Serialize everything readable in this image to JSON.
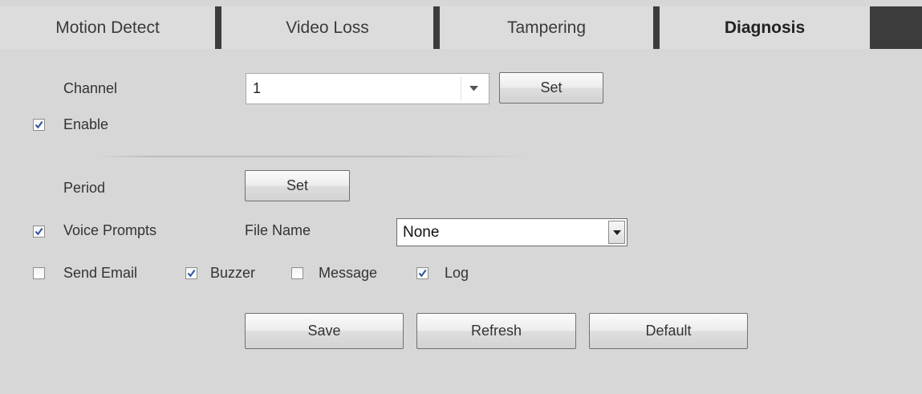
{
  "tabs": [
    {
      "label": "Motion Detect",
      "active": false
    },
    {
      "label": "Video Loss",
      "active": false
    },
    {
      "label": "Tampering",
      "active": false
    },
    {
      "label": "Diagnosis",
      "active": true
    }
  ],
  "channel": {
    "label": "Channel",
    "value": "1",
    "set_label": "Set"
  },
  "enable": {
    "label": "Enable",
    "checked": true
  },
  "period": {
    "label": "Period",
    "set_label": "Set"
  },
  "voice_prompts": {
    "label": "Voice Prompts",
    "checked": true,
    "file_name_label": "File Name",
    "file_name_value": "None"
  },
  "actions": {
    "send_email": {
      "label": "Send Email",
      "checked": false
    },
    "buzzer": {
      "label": "Buzzer",
      "checked": true
    },
    "message": {
      "label": "Message",
      "checked": false
    },
    "log": {
      "label": "Log",
      "checked": true
    }
  },
  "buttons": {
    "save": "Save",
    "refresh": "Refresh",
    "default": "Default"
  },
  "colors": {
    "background": "#d7d7d7",
    "tab_bg": "#dcdcdc",
    "tab_separator": "#3c3c3c",
    "check_mark": "#2a4fa0"
  }
}
